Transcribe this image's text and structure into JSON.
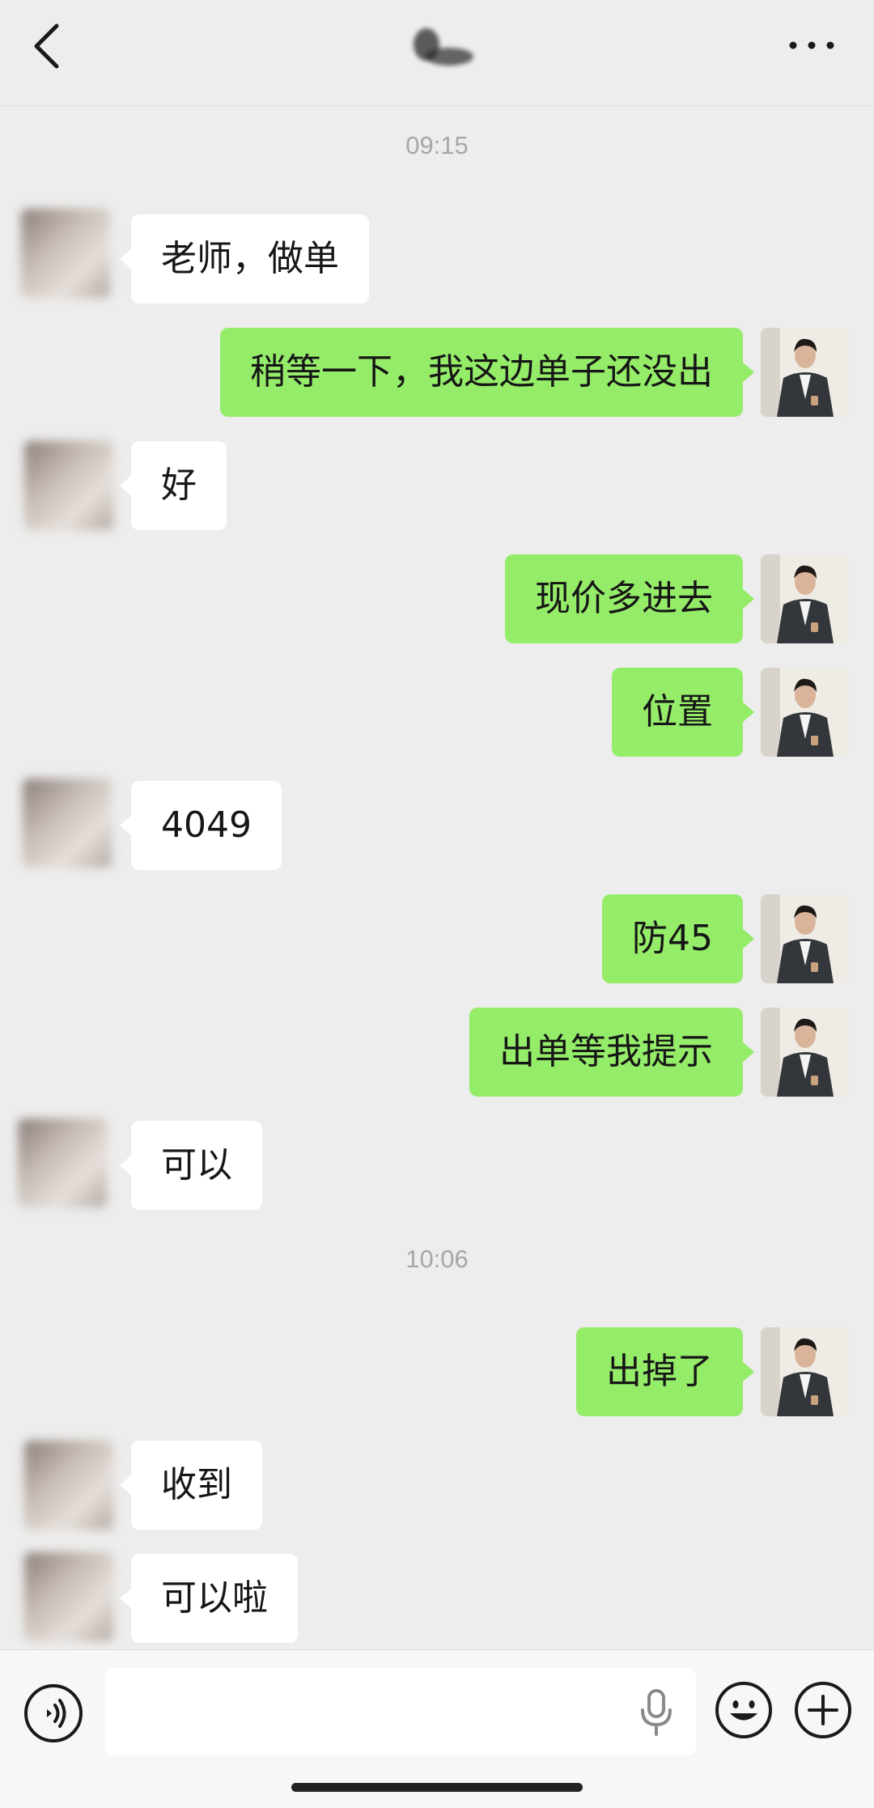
{
  "header": {
    "back_icon": "chevron-left-icon",
    "contact_name": "",
    "more_icon": "ellipsis-icon"
  },
  "timestamps": [
    "09:15",
    "10:06"
  ],
  "messages": [
    {
      "direction": "in",
      "text": "老师，做单"
    },
    {
      "direction": "out",
      "text": "稍等一下，我这边单子还没出"
    },
    {
      "direction": "in",
      "text": "好"
    },
    {
      "direction": "out",
      "text": "现价多进去"
    },
    {
      "direction": "out",
      "text": "位置"
    },
    {
      "direction": "in",
      "text": "4049"
    },
    {
      "direction": "out",
      "text": "防45"
    },
    {
      "direction": "out",
      "text": "出单等我提示"
    },
    {
      "direction": "in",
      "text": "可以"
    },
    {
      "direction": "out",
      "text": "出掉了"
    },
    {
      "direction": "in",
      "text": "收到"
    },
    {
      "direction": "in",
      "text": "可以啦"
    }
  ],
  "input_bar": {
    "voice_icon": "voice-icon",
    "text_value": "",
    "mic_icon": "microphone-icon",
    "emoji_icon": "emoji-icon",
    "plus_icon": "plus-circle-icon"
  },
  "colors": {
    "background": "#ededed",
    "incoming_bubble": "#ffffff",
    "outgoing_bubble": "#95ec69",
    "timestamp_text": "#a7a7a7"
  }
}
